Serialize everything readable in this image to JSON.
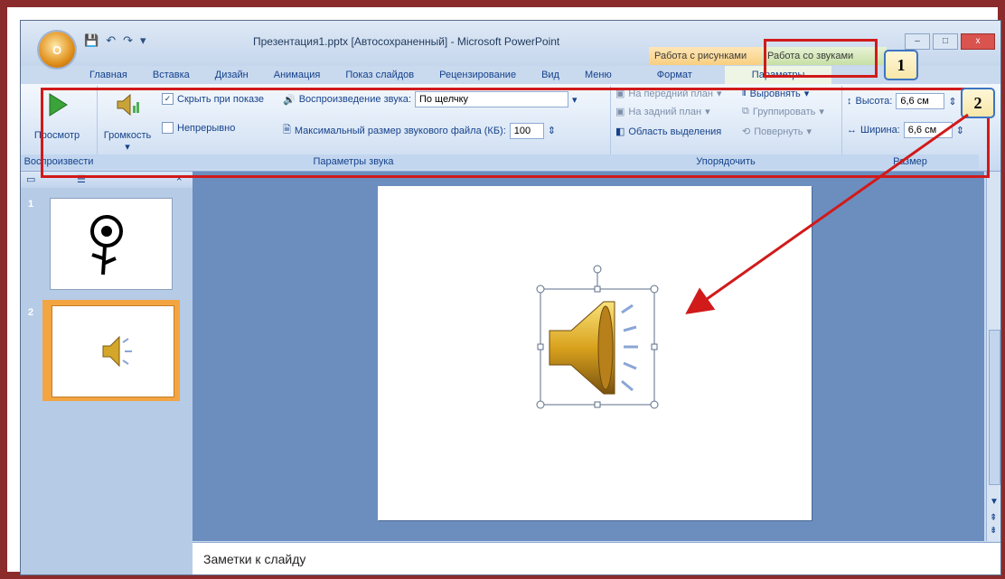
{
  "window": {
    "title": "Презентация1.pptx [Автосохраненный] - Microsoft PowerPoint",
    "context_tabs": [
      "Работа с рисунками",
      "Работа со звуками"
    ],
    "min": "–",
    "max": "□",
    "close": "x"
  },
  "tabs": [
    "Главная",
    "Вставка",
    "Дизайн",
    "Анимация",
    "Показ слайдов",
    "Рецензирование",
    "Вид",
    "Меню",
    "Формат",
    "Параметры"
  ],
  "ribbon": {
    "play": {
      "label": "Просмотр",
      "group": "Воспроизвести"
    },
    "sound_params": {
      "volume": "Громкость",
      "hide": "Скрыть при показе",
      "hide_checked": true,
      "loop": "Непрерывно",
      "loop_checked": false,
      "playback_label": "Воспроизведение звука:",
      "playback_value": "По щелчку",
      "maxsize_label": "Максимальный размер звукового файла (КБ):",
      "maxsize_value": "100",
      "group": "Параметры звука"
    },
    "arrange": {
      "front": "На передний план",
      "back": "На задний план",
      "selection": "Область выделения",
      "align": "Выровнять",
      "group_btn": "Группировать",
      "rotate": "Повернуть",
      "group": "Упорядочить"
    },
    "size": {
      "height_label": "Высота:",
      "height_value": "6,6 см",
      "width_label": "Ширина:",
      "width_value": "6,6 см",
      "group": "Размер"
    }
  },
  "callouts": [
    "1",
    "2"
  ],
  "slides": [
    {
      "num": "1"
    },
    {
      "num": "2"
    }
  ],
  "notes": "Заметки к слайду",
  "colors": {
    "annotation": "#d11a1a",
    "accent": "#f3a542"
  }
}
